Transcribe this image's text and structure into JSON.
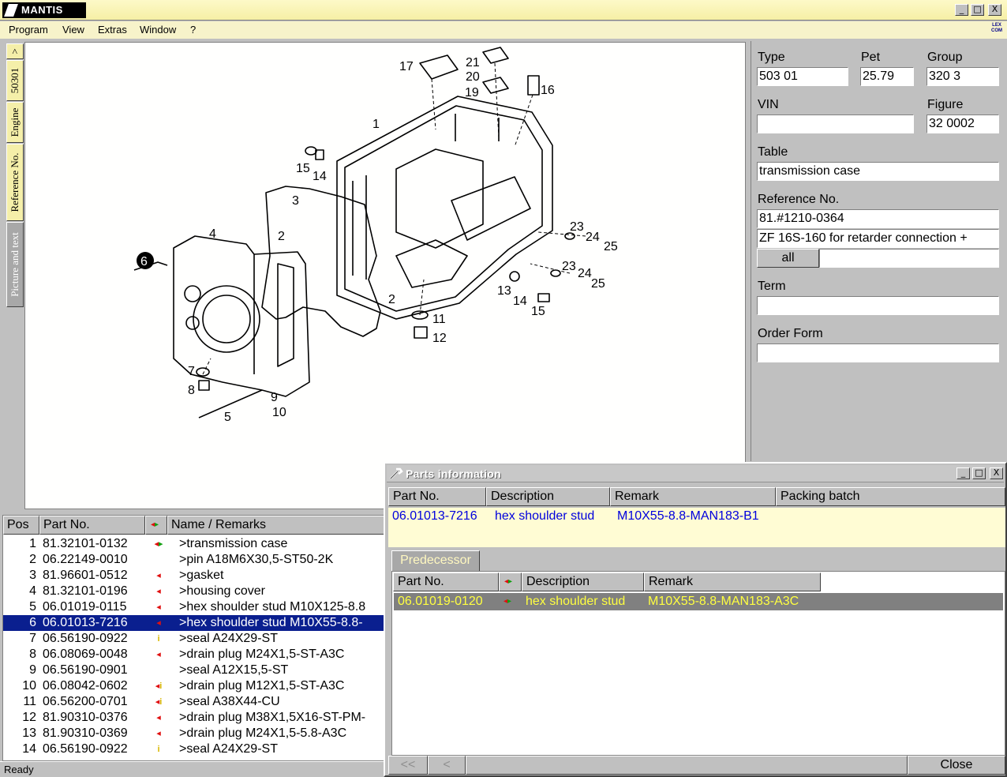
{
  "app": {
    "logo": "MANTIS"
  },
  "window_controls": {
    "minimize": "_",
    "maximize": "□",
    "close": "X"
  },
  "menu": [
    "Program",
    "View",
    "Extras",
    "Window",
    "?"
  ],
  "menu_icon_text": "LEX COM",
  "side_tabs": [
    {
      "label": ">"
    },
    {
      "label": "50301"
    },
    {
      "label": "Engine"
    },
    {
      "label": "Reference No."
    },
    {
      "label": "Picture and text"
    }
  ],
  "drawing": {
    "callouts": [
      "17",
      "21",
      "20",
      "19",
      "16",
      "1",
      "15",
      "14",
      "3",
      "2",
      "4",
      "6",
      "23",
      "24",
      "25",
      "23",
      "24",
      "25",
      "13",
      "14",
      "15",
      "2",
      "11",
      "12",
      "7",
      "8",
      "9",
      "10",
      "5"
    ]
  },
  "info_panel": {
    "type_label": "Type",
    "type_value": "503 01",
    "pet_label": "Pet",
    "pet_value": "25.79",
    "group_label": "Group",
    "group_value": "320 3",
    "vin_label": "VIN",
    "vin_value": "",
    "figure_label": "Figure",
    "figure_value": "32 0002",
    "table_label": "Table",
    "table_value": "transmission case",
    "reference_label": "Reference No.",
    "reference_value": "81.#1210-0364",
    "reference_desc": "ZF 16S-160 for retarder connection +",
    "all_button": "all",
    "term_label": "Term",
    "term_value": "",
    "order_label": "Order Form",
    "order_value": ""
  },
  "parts_list": {
    "headers": {
      "pos": "Pos",
      "part": "Part No.",
      "name": "Name / Remarks"
    },
    "rows": [
      {
        "pos": "1",
        "part": "81.32101-0132",
        "ind": "rg",
        "name": ">transmission case"
      },
      {
        "pos": "2",
        "part": "06.22149-0010",
        "ind": "",
        "name": ">pin A18M6X30,5-ST50-2K"
      },
      {
        "pos": "3",
        "part": "81.96601-0512",
        "ind": "r",
        "name": ">gasket"
      },
      {
        "pos": "4",
        "part": "81.32101-0196",
        "ind": "r",
        "name": ">housing cover"
      },
      {
        "pos": "5",
        "part": "06.01019-0115",
        "ind": "r",
        "name": ">hex shoulder stud M10X125-8.8"
      },
      {
        "pos": "6",
        "part": "06.01013-7216",
        "ind": "r",
        "name": ">hex shoulder stud M10X55-8.8-"
      },
      {
        "pos": "7",
        "part": "06.56190-0922",
        "ind": "i",
        "name": ">seal A24X29-ST"
      },
      {
        "pos": "8",
        "part": "06.08069-0048",
        "ind": "r",
        "name": ">drain plug M24X1,5-ST-A3C"
      },
      {
        "pos": "9",
        "part": "06.56190-0901",
        "ind": "",
        "name": ">seal A12X15,5-ST"
      },
      {
        "pos": "10",
        "part": "06.08042-0602",
        "ind": "ri",
        "name": ">drain plug M12X1,5-ST-A3C"
      },
      {
        "pos": "11",
        "part": "06.56200-0701",
        "ind": "ri",
        "name": ">seal A38X44-CU"
      },
      {
        "pos": "12",
        "part": "81.90310-0376",
        "ind": "r",
        "name": ">drain plug M38X1,5X16-ST-PM-"
      },
      {
        "pos": "13",
        "part": "81.90310-0369",
        "ind": "r",
        "name": ">drain plug M24X1,5-5.8-A3C"
      },
      {
        "pos": "14",
        "part": "06.56190-0922",
        "ind": "i",
        "name": ">seal A24X29-ST"
      }
    ],
    "selected_index": 5
  },
  "status": {
    "text": "Ready"
  },
  "parts_info": {
    "title": "Parts information",
    "headers": {
      "part": "Part No.",
      "desc": "Description",
      "remark": "Remark",
      "packing": "Packing batch"
    },
    "row": {
      "part": "06.01013-7216",
      "desc": "hex shoulder stud",
      "remark": "M10X55-8.8-MAN183-B1"
    },
    "predecessor_tab": "Predecessor",
    "pred_headers": {
      "part": "Part No.",
      "desc": "Description",
      "remark": "Remark"
    },
    "pred_row": {
      "part": "06.01019-0120",
      "desc": "hex shoulder stud",
      "remark": "M10X55-8.8-MAN183-A3C"
    },
    "buttons": {
      "first": "<<",
      "prev": "<",
      "close": "Close"
    }
  },
  "colors": {
    "title_yellow": "#f6efa5",
    "selection": "#0a1f8f",
    "info_blue": "#0000dd",
    "pred_yellow": "#ffff40"
  }
}
